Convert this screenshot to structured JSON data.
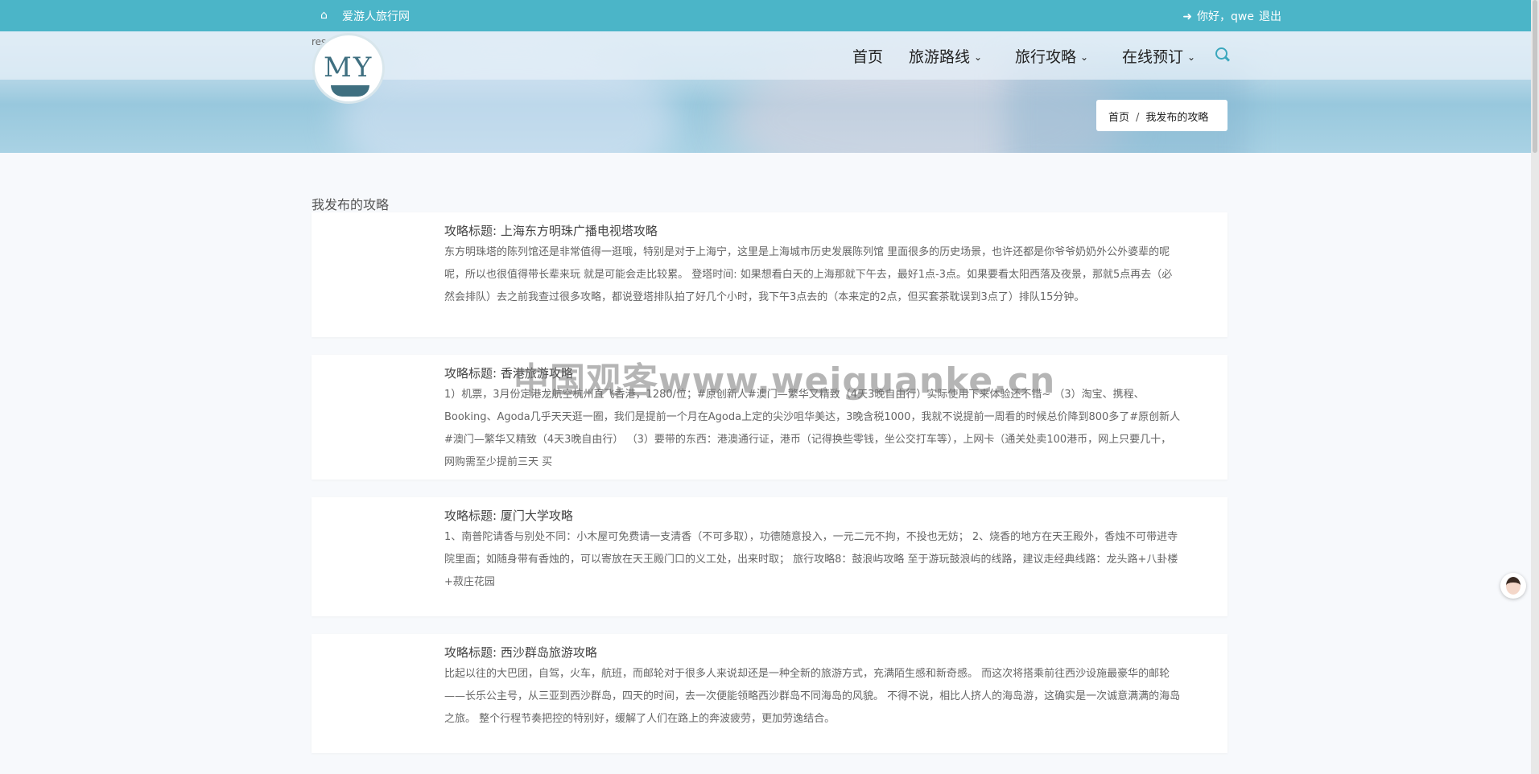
{
  "topbar": {
    "home_icon": "home-icon",
    "site_name": "爱游人旅行网",
    "login_icon": "sign-in-icon",
    "greeting": "你好，qwe",
    "logout": "退出"
  },
  "header": {
    "res_text": "res",
    "logo_text": "MY",
    "nav": [
      {
        "label": "首页"
      },
      {
        "label": "旅游路线",
        "has_dropdown": true
      },
      {
        "label": "旅行攻略",
        "has_dropdown": true
      },
      {
        "label": "在线预订",
        "has_dropdown": true
      }
    ],
    "search_icon": "search-icon",
    "chevron_icon": "chevron-down-icon"
  },
  "breadcrumb": {
    "home": "首页",
    "separator": "/",
    "current": "我发布的攻略"
  },
  "main": {
    "section_title": "我发布的攻略",
    "items": [
      {
        "title": "攻略标题: 上海东方明珠广播电视塔攻略",
        "body": "东方明珠塔的陈列馆还是非常值得一逛哦，特别是对于上海宁，这里是上海城市历史发展陈列馆 里面很多的历史场景，也许还都是你爷爷奶奶外公外婆辈的呢呢，所以也很值得带长辈来玩 就是可能会走比较累。          登塔时间:          如果想看白天的上海那就下午去，最好1点-3点。如果要看太阳西落及夜景，那就5点再去（必然会排队）去之前我查过很多攻略，都说登塔排队拍了好几个小时，我下午3点去的（本来定的2点，但买套茶耽误到3点了）排队15分钟。"
      },
      {
        "title": "攻略标题: 香港旅游攻略",
        "body": "1）机票，3月份定港龙航空杭州直飞香港，1280/位；#原创新人#澳门—繁华又精致（4天3晚自由行）实际使用下来体验还不错~          （3）淘宝、携程、Booking、Agoda几乎天天逛一圈，我们是提前一个月在Agoda上定的尖沙咀华美达，3晚含税1000，我就不说提前一周看的时候总价降到800多了#原创新人#澳门—繁华又精致（4天3晚自由行）          （3）要带的东西：港澳通行证，港币（记得换些零钱，坐公交打车等），上网卡（通关处卖100港币，网上只要几十，网购需至少提前三天     买"
      },
      {
        "title": "攻略标题: 厦门大学攻略",
        "body": "1、南普陀请香与别处不同：小木屋可免费请一支清香（不可多取），功德随意投入，一元二元不拘，不投也无妨；          2、烧香的地方在天王殿外，香烛不可带进寺院里面；如随身带有香烛的，可以寄放在天王殿门口的义工处，出来时取；  旅行攻略8：鼓浪屿攻略 至于游玩鼓浪屿的线路，建议走经典线路：龙头路+八卦楼+菽庄花园"
      },
      {
        "title": "攻略标题: 西沙群岛旅游攻略",
        "body": "比起以往的大巴团，自驾，火车，航班，而邮轮对于很多人来说却还是一种全新的旅游方式，充满陌生感和新奇感。          而这次将搭乘前往西沙设施最豪华的邮轮——长乐公主号，从三亚到西沙群岛，四天的时间，去一次便能领略西沙群岛不同海岛的风貌。          不得不说，相比人挤人的海岛游，这确实是一次诚意满满的海岛之旅。          整个行程节奏把控的特别好，缓解了人们在路上的奔波疲劳，更加劳逸结合。"
      }
    ]
  },
  "watermark": "中国观客www.weiguanke.cn",
  "chat_avatar_icon": "customer-service-avatar-icon"
}
